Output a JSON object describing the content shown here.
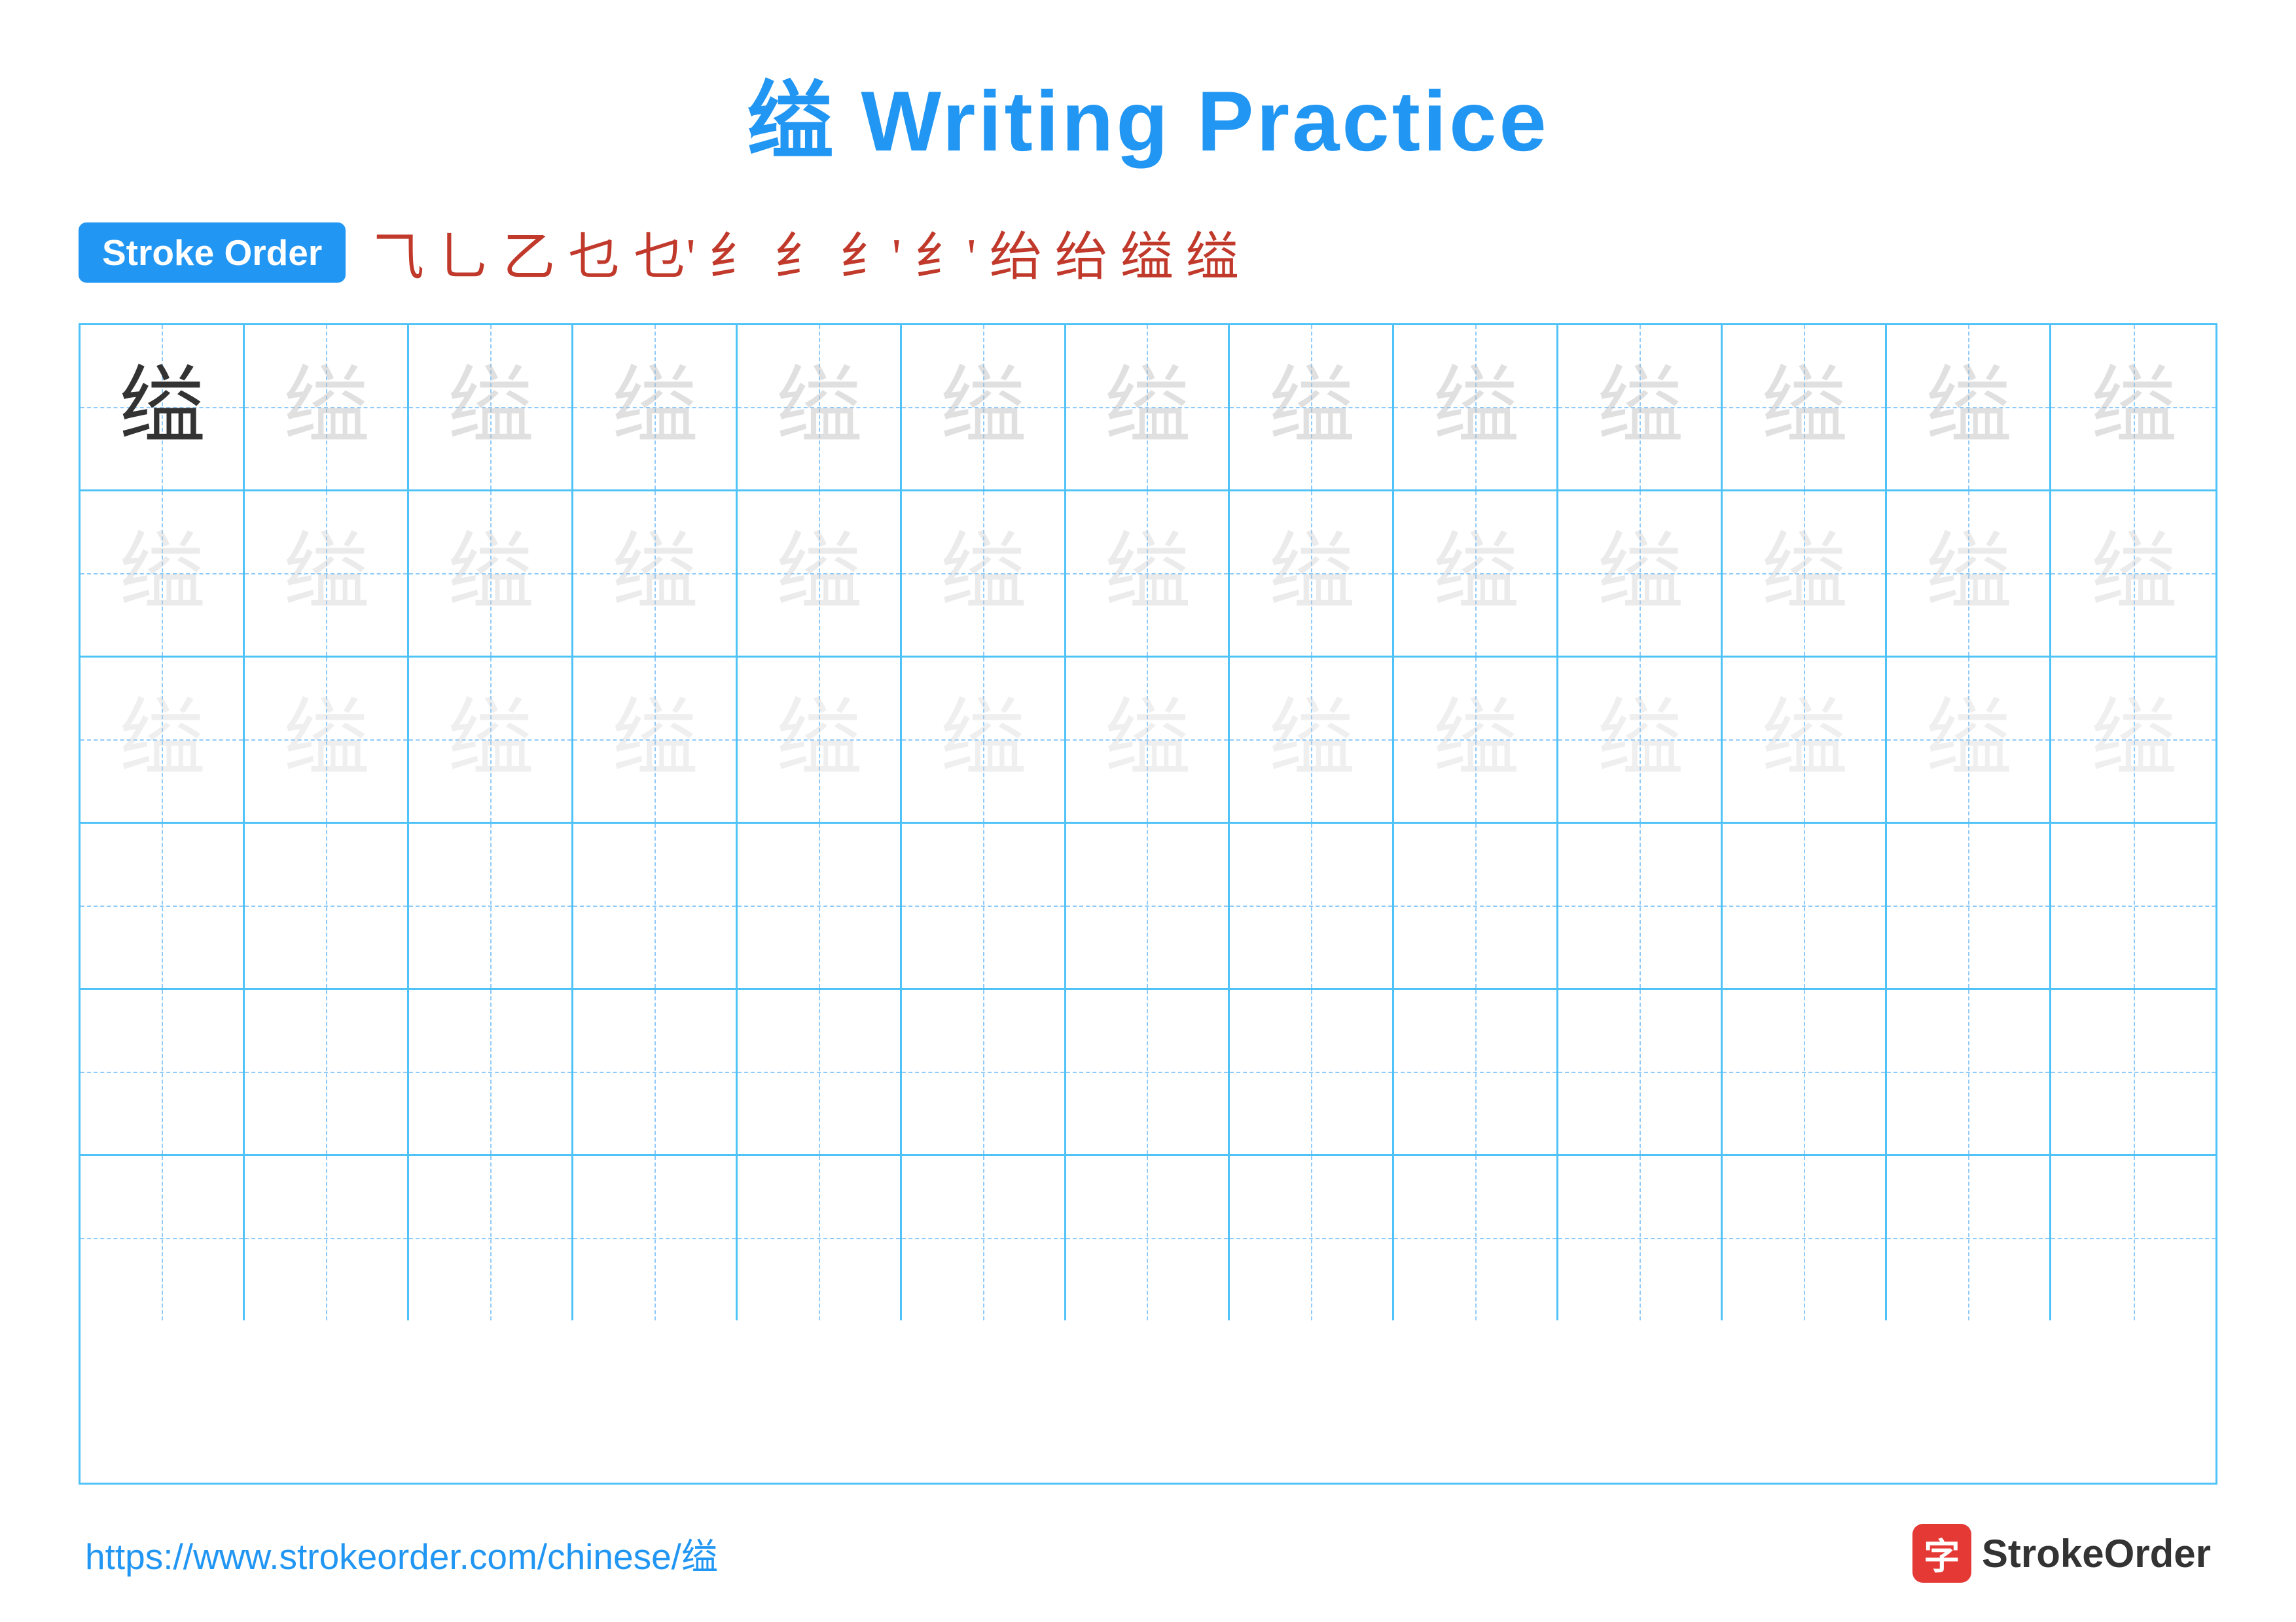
{
  "title": {
    "char": "缢",
    "text": " Writing Practice"
  },
  "stroke_order": {
    "badge_label": "Stroke Order",
    "steps": [
      "⺄",
      "乚",
      "乙",
      "乜",
      "乜'",
      "纟",
      "纟",
      "纟'",
      "纟'",
      "绐",
      "绐",
      "缢",
      "缢"
    ]
  },
  "grid": {
    "char": "缢",
    "rows": [
      {
        "type": "practice",
        "first_dark": true,
        "opacity": "light"
      },
      {
        "type": "practice",
        "first_dark": false,
        "opacity": "lighter"
      },
      {
        "type": "practice",
        "first_dark": false,
        "opacity": "lightest"
      },
      {
        "type": "empty"
      },
      {
        "type": "empty"
      },
      {
        "type": "empty"
      }
    ],
    "cols": 13
  },
  "footer": {
    "url": "https://www.strokeorder.com/chinese/缢",
    "logo_text": "StrokeOrder",
    "logo_char": "字"
  }
}
